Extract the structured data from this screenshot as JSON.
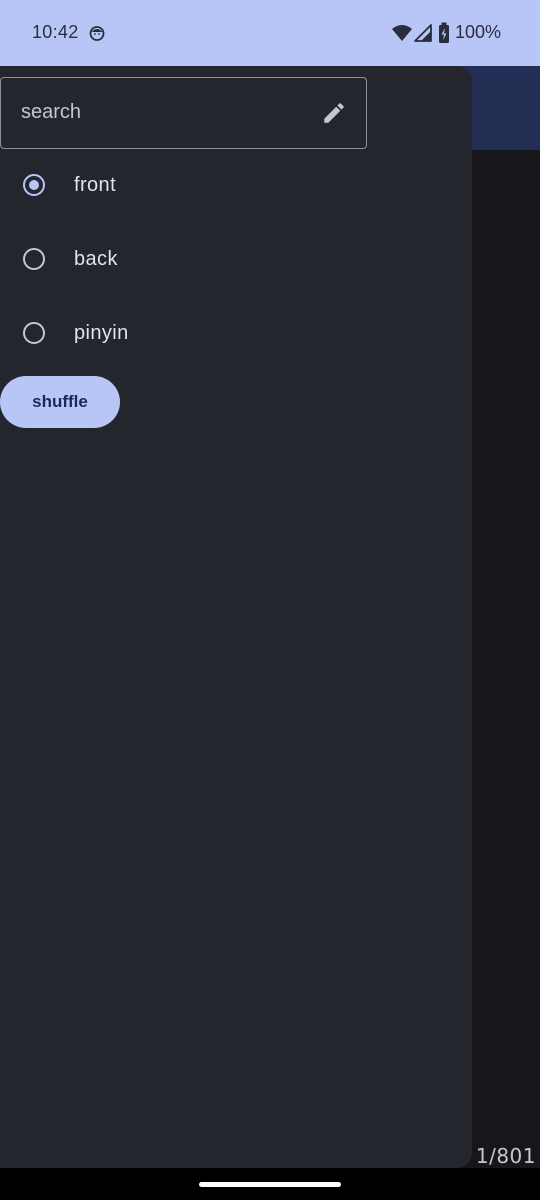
{
  "status_bar": {
    "time": "10:42",
    "battery": "100%",
    "icons": [
      "app-notification-icon",
      "wifi-icon",
      "signal-icon",
      "battery-icon"
    ]
  },
  "drawer": {
    "search": {
      "placeholder": "search",
      "value": "",
      "edit_icon": "pencil-icon"
    },
    "options": [
      {
        "label": "front",
        "selected": true
      },
      {
        "label": "back",
        "selected": false
      },
      {
        "label": "pinyin",
        "selected": false
      }
    ],
    "shuffle_label": "shuffle"
  },
  "main": {
    "counter": "1/801"
  },
  "colors": {
    "accent": "#b8c5f7",
    "drawer_bg": "#24262d",
    "app_bar": "#232e55",
    "main_bg": "#17171b",
    "on_accent": "#1b2a5a"
  }
}
